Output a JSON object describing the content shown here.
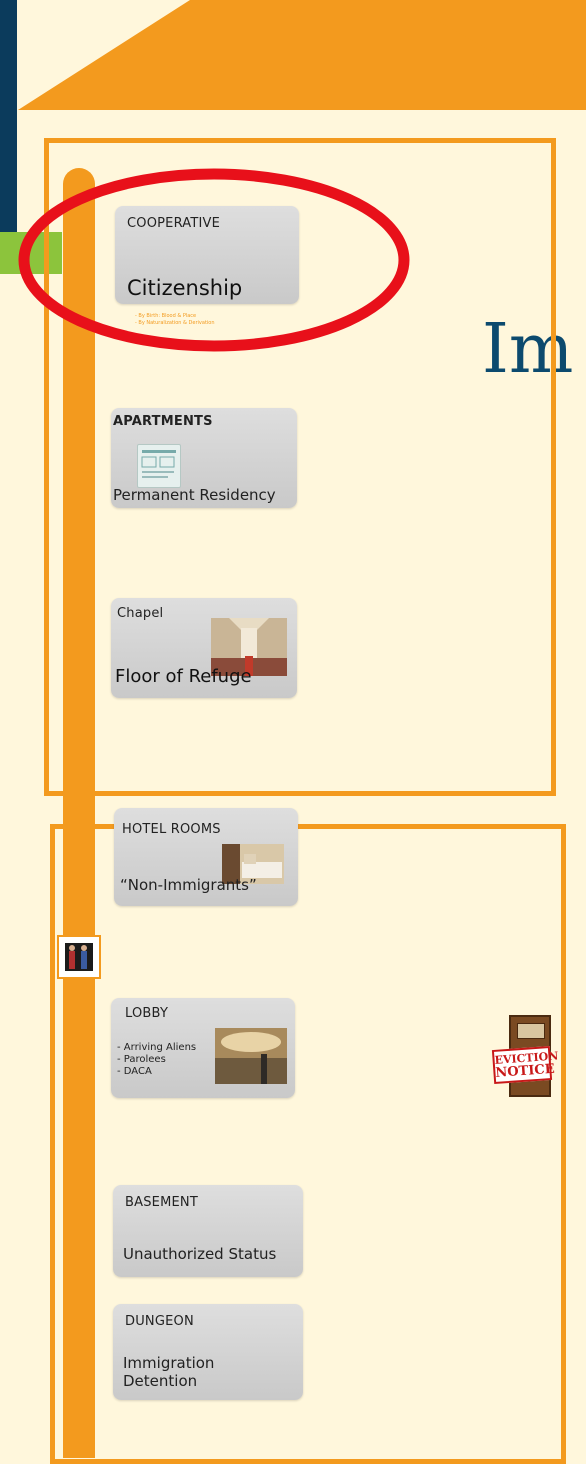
{
  "title_fragment": "Im",
  "floors": {
    "cooperative": {
      "label": "COOPERATIVE",
      "title": "Citizenship",
      "notes": [
        "- By Birth: Blood & Place",
        "- By Naturalization & Derivation"
      ]
    },
    "apartments": {
      "label": "APARTMENTS",
      "title": "Permanent Residency"
    },
    "chapel": {
      "label": "Chapel",
      "title": "Floor of Refuge"
    },
    "hotel": {
      "label": "HOTEL ROOMS",
      "title": "“Non-Immigrants”"
    },
    "lobby": {
      "label": "LOBBY",
      "items": [
        "- Arriving Aliens",
        "- Parolees",
        "- DACA"
      ]
    },
    "basement": {
      "label": "BASEMENT",
      "title": "Unauthorized Status"
    },
    "dungeon": {
      "label": "DUNGEON",
      "title_line1": "Immigration",
      "title_line2": "Detention"
    }
  },
  "eviction": {
    "line1": "EVICTION",
    "line2": "NOTICE"
  },
  "colors": {
    "orange": "#f39a1e",
    "navy": "#0b3b5c",
    "green": "#8cc43c",
    "red_circle": "#e8101a",
    "title_blue": "#0c4a6e"
  },
  "icons": [
    "elevator-person-icon",
    "door-icon",
    "document-icon"
  ]
}
